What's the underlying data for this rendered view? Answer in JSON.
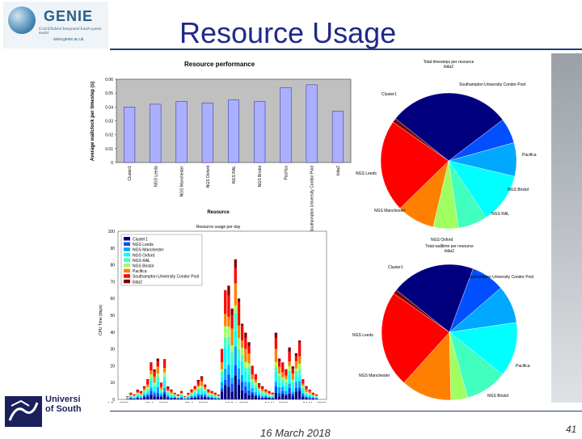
{
  "slide": {
    "title": "Resource Usage",
    "date": "16 March 2018",
    "page": "41"
  },
  "logo": {
    "word": "GENIE",
    "sub": "Grid ENabled Integrated Earth system model",
    "url": "www.genie.ac.uk"
  },
  "university": {
    "line1": "Universi",
    "line2": "of South"
  },
  "colors": {
    "title": "#1f2a8a",
    "bar": "#aab0ff",
    "plot_bg": "#c0c0c0"
  },
  "chart_data": [
    {
      "type": "bar",
      "title": "Resource performance",
      "ylabel": "Average wallclock per timestep (s)",
      "xlabel": "Resource",
      "ylim": [
        0,
        0.06
      ],
      "yticks": [
        "0",
        "0.01",
        "0.02",
        "0.03",
        "0.04",
        "0.05",
        "0.06"
      ],
      "categories": [
        "Cluster1",
        "NGS Leeds",
        "NGS Manchester",
        "NGS Oxford",
        "NGS RAL",
        "NGS Bristol",
        "Pacifica",
        "Southampton University Condor Pool",
        "tiida2"
      ],
      "values": [
        0.04,
        0.042,
        0.044,
        0.043,
        0.045,
        0.044,
        0.054,
        0.056,
        0.037
      ]
    },
    {
      "type": "pie",
      "title": "Total timesteps per resource",
      "subtitle": "tiida2",
      "labels": [
        "Cluster1",
        "NGS Leeds",
        "NGS Manchester",
        "NGS Oxford",
        "NGS RAL",
        "NGS Bristol",
        "Pacifica",
        "Southampton University Condor Pool",
        "tiida2"
      ],
      "shown_labels": [
        "Cluster1",
        "Southampton University Condor Pool",
        "Pacifica",
        "NGS Bristol",
        "NGS RAL",
        "NGS Oxford",
        "NGS Manchester",
        "NGS Leeds"
      ],
      "values": [
        0.29,
        0.06,
        0.08,
        0.12,
        0.07,
        0.06,
        0.09,
        0.22,
        0.01
      ],
      "colors": [
        "#00007f",
        "#0050ff",
        "#00a8ff",
        "#00ffff",
        "#40ffbf",
        "#a0ff60",
        "#ff8000",
        "#ff0000",
        "#7f0000"
      ]
    },
    {
      "type": "bar",
      "stacked": true,
      "title": "Resource usage per day",
      "ylabel": "CPU Time (days)",
      "xlabel": "Date",
      "ylim": [
        0,
        100
      ],
      "yticks": [
        "0",
        "10",
        "20",
        "30",
        "40",
        "50",
        "60",
        "70",
        "80",
        "90",
        "100"
      ],
      "xticks": [
        "4-Dec-2005",
        "03-Jan-2006",
        "22-Jan-2006",
        "12-Feb-2006",
        "04-Mar-2006",
        "24-Mar-2006"
      ],
      "legend": [
        "Cluster1",
        "NGS Leeds",
        "NGS Manchester",
        "NGS Oxford",
        "NGS RAL",
        "NGS Bristol",
        "Pacifica",
        "Southampton University Condor Pool",
        "tiida2"
      ],
      "legend_position": "top-left",
      "colors": [
        "#00007f",
        "#0050ff",
        "#00a8ff",
        "#00ffff",
        "#40ffbf",
        "#a0ff60",
        "#ff8000",
        "#ff0000",
        "#7f0000"
      ],
      "daily_totals_approx": [
        2,
        4,
        3,
        6,
        5,
        8,
        12,
        22,
        18,
        25,
        10,
        24,
        8,
        6,
        4,
        3,
        5,
        2,
        4,
        6,
        8,
        12,
        14,
        9,
        6,
        5,
        4,
        3,
        30,
        65,
        70,
        55,
        85,
        60,
        45,
        40,
        35,
        20,
        15,
        10,
        8,
        6,
        5,
        4,
        40,
        25,
        22,
        18,
        32,
        20,
        28,
        35,
        12,
        8,
        6,
        4,
        3
      ]
    },
    {
      "type": "pie",
      "title": "Total walltime per resource",
      "subtitle": "tiida2",
      "labels": [
        "Cluster1",
        "NGS Leeds",
        "NGS Manchester",
        "NGS Oxford",
        "NGS RAL",
        "NGS Bristol",
        "Pacifica",
        "Southampton University Condor Pool",
        "tiida2"
      ],
      "shown_labels": [
        "Cluster1",
        "Southampton University Condor Pool",
        "Pacifica",
        "NGS Bristol",
        "NGS RAL",
        "NGS Oxford",
        "NGS Manchester",
        "NGS Leeds"
      ],
      "values": [
        0.2,
        0.08,
        0.09,
        0.13,
        0.1,
        0.04,
        0.12,
        0.23,
        0.01
      ],
      "colors": [
        "#00007f",
        "#0050ff",
        "#00a8ff",
        "#00ffff",
        "#40ffbf",
        "#a0ff60",
        "#ff8000",
        "#ff0000",
        "#7f0000"
      ]
    }
  ]
}
